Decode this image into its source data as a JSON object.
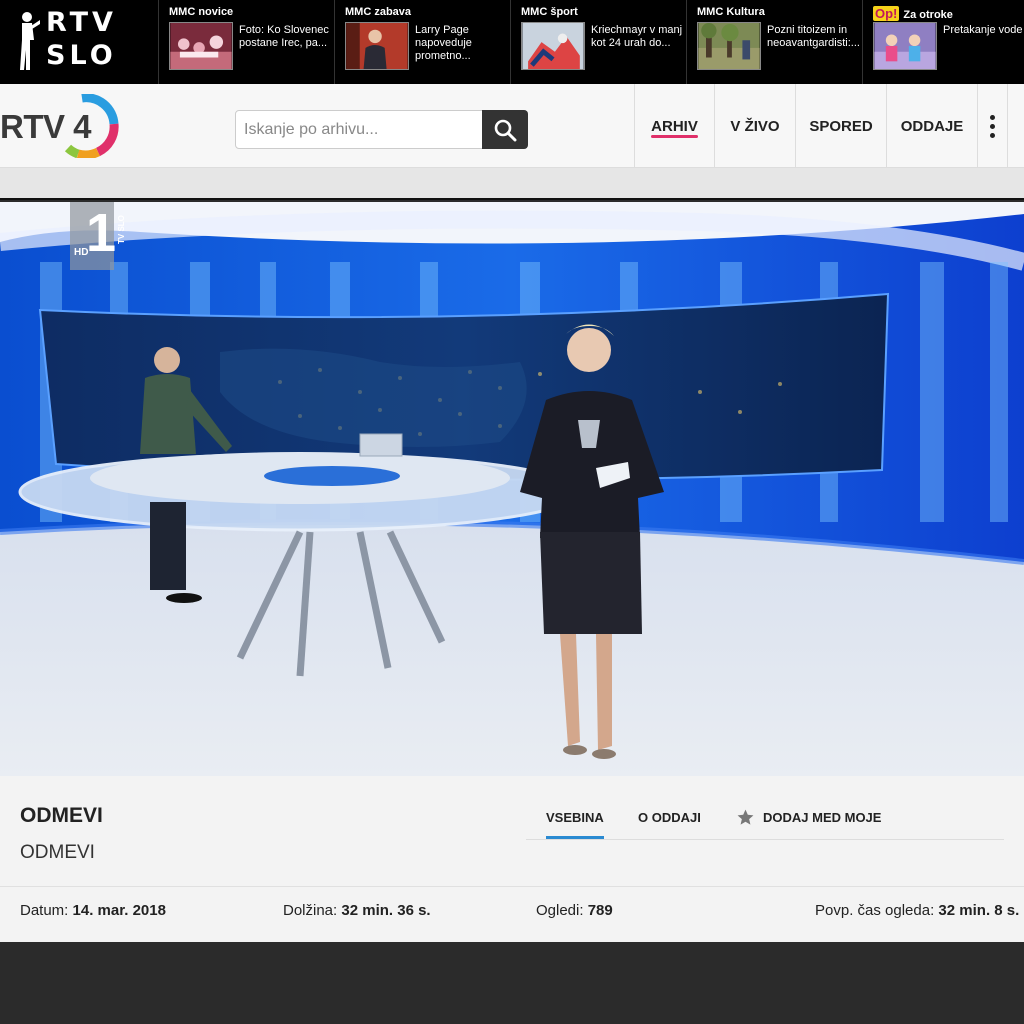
{
  "top_strip": {
    "logo": {
      "line1": "RTV",
      "line2": "SLO"
    },
    "items": [
      {
        "section": "MMC novice",
        "text": "Foto: Ko Slovenec postane Irec, pa..."
      },
      {
        "section": "MMC zabava",
        "text": "Larry Page napoveduje prometno..."
      },
      {
        "section": "MMC šport",
        "text": "Kriechmayr v manj kot 24 urah do..."
      },
      {
        "section": "MMC Kultura",
        "text": "Pozni titoizem in neoavantgardisti:..."
      },
      {
        "badge": "Op!",
        "section": "Za otroke",
        "text": "Pretakanje vode"
      }
    ]
  },
  "header": {
    "logo_text": "RTV 4",
    "search": {
      "placeholder": "Iskanje po arhivu..."
    },
    "nav": [
      "ARHIV",
      "V ŽIVO",
      "SPORED",
      "ODDAJE"
    ],
    "active_nav": "ARHIV",
    "accent_color": "#e0306a"
  },
  "video": {
    "channel_badge": "HD",
    "channel": "1",
    "channel_label": "TV SLO"
  },
  "show": {
    "title": "ODMEVI",
    "subtitle": "ODMEVI",
    "tabs": [
      "VSEBINA",
      "O ODDAJI",
      "DODAJ MED MOJE"
    ],
    "active_tab": "VSEBINA",
    "tab_accent": "#2a8ad1"
  },
  "meta": {
    "date_label": "Datum:",
    "date_value": "14. mar. 2018",
    "length_label": "Dolžina:",
    "length_value": "32 min. 36 s.",
    "views_label": "Ogledi:",
    "views_value": "789",
    "avg_label": "Povp. čas ogleda:",
    "avg_value": "32 min. 8 s."
  }
}
